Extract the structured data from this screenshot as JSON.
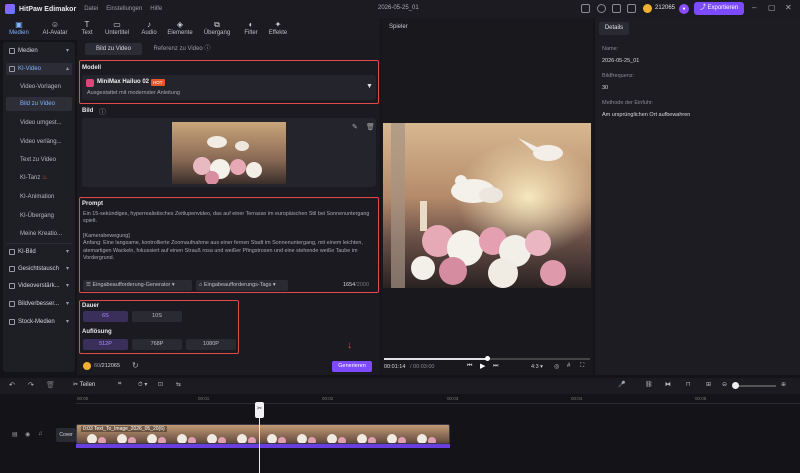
{
  "app": {
    "name": "HitPaw Edimakor",
    "menus": [
      "Datei",
      "Einstellungen",
      "Hilfe"
    ],
    "doc_title": "2026-05-25_01",
    "credits": "212065",
    "export_label": "Exportieren",
    "accent": "#7d4bff"
  },
  "toolbar": {
    "items": [
      {
        "label": "Medien",
        "icon": "media-icon"
      },
      {
        "label": "AI-Avatar",
        "icon": "avatar-icon"
      },
      {
        "label": "Text",
        "icon": "text-icon"
      },
      {
        "label": "Untertitel",
        "icon": "subtitle-icon"
      },
      {
        "label": "Audio",
        "icon": "audio-icon"
      },
      {
        "label": "Elemente",
        "icon": "elements-icon"
      },
      {
        "label": "Übergang",
        "icon": "transition-icon"
      },
      {
        "label": "Filter",
        "icon": "filter-icon"
      },
      {
        "label": "Effekte",
        "icon": "effects-icon"
      }
    ]
  },
  "sidebar": {
    "medien": "Medien",
    "ki_video": "KI-Video",
    "sub": [
      "Video-Vorlagen",
      "Bild zu Video",
      "Video umgest...",
      "Video verläng...",
      "Text zu Video",
      "KI-Tanz",
      "KI-Animation",
      "KI-Übergang",
      "Meine Kreatio..."
    ],
    "groups": [
      "KI-Bild",
      "Gesichtstausch",
      "Videoverstärk...",
      "Bildverbesser...",
      "Stock-Medien"
    ]
  },
  "panel": {
    "tab_active": "Bild zu Video",
    "tab_other": "Referenz zu Video",
    "model_label": "Modell",
    "model_name": "MiniMax Hailuo 02",
    "model_badge": "HOT",
    "model_desc": "Ausgestattet mit modernster Anleitung",
    "image_label": "Bild",
    "prompt_label": "Prompt",
    "prompt_p1": "Ein 15-sekündiges, hyperrealistisches Zeitlupenvideo, das auf einer Terrasse im europäischen Stil bei Sonnenuntergang spielt.",
    "prompt_p2": "[Kamerabewegung]",
    "prompt_p3": "Anfang: Eine langsame, kontrollierte Zoomaufnahme aus einer fernen Stadt im Sonnenuntergang, mit einem leichten, atemartigen Wackeln, fokussiert auf einen Strauß rosa und weißer Pfingstrosen und eine stehende weiße Taube im Vordergrund.",
    "gen_btn": "Eingabeaufforderung-Generator",
    "tags_btn": "Eingabeaufforderungs-Tags",
    "char_count": "1654",
    "char_max": "/2000",
    "duration_label": "Dauer",
    "durations": [
      "6S",
      "10S"
    ],
    "resolution_label": "Auflösung",
    "resolutions": [
      "512P",
      "768P",
      "1080P"
    ],
    "cost": "60",
    "cost_total": "/212065",
    "generate": "Generieren"
  },
  "player": {
    "label": "Spieler",
    "current_time": "00:01:14",
    "total_time": "/ 00:03:00",
    "ratio": "4:3",
    "progress": 0.5
  },
  "details": {
    "tab": "Details",
    "name_key": "Name:",
    "name_val": "2026-05-25_01",
    "fps_key": "Bildfrequenz:",
    "fps_val": "30",
    "method_key": "Methode der Einfuhr:",
    "method_val": "Am ursprünglichen Ort aufbewahren"
  },
  "timeline": {
    "split_label": "Teilen",
    "ticks": [
      "00:00",
      "00:01",
      "00:02",
      "00:03",
      "00:04",
      "00:05"
    ],
    "cover_label": "Cover",
    "clip_label": "0:03  Text_To_Image_2026_05_20(6)"
  }
}
